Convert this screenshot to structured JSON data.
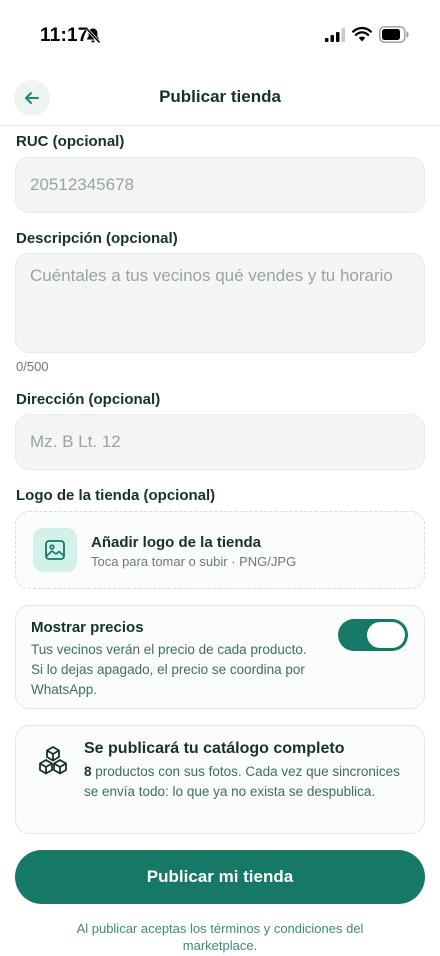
{
  "status_bar": {
    "time": "11:17"
  },
  "header": {
    "title": "Publicar tienda"
  },
  "form": {
    "ruc": {
      "label": "RUC (opcional)",
      "placeholder": "20512345678"
    },
    "descripcion": {
      "label": "Descripción (opcional)",
      "placeholder": "Cuéntales a tus vecinos qué vendes y tu horario",
      "counter": "0/500"
    },
    "direccion": {
      "label": "Dirección (opcional)",
      "placeholder": "Mz. B Lt. 12"
    },
    "logo": {
      "label": "Logo de la tienda (opcional)",
      "title": "Añadir logo de la tienda",
      "subtitle": "Toca para tomar o subir · PNG/JPG"
    }
  },
  "prices": {
    "title": "Mostrar precios",
    "description": "Tus vecinos verán el precio de cada producto. Si lo dejas apagado, el precio se coordina por WhatsApp.",
    "enabled": true
  },
  "catalog": {
    "title": "Se publicará tu catálogo completo",
    "count": "8",
    "description": " productos con sus fotos. Cada vez que sincronices se envía todo: lo que ya no exista se despublica."
  },
  "actions": {
    "publish_label": "Publicar mi tienda",
    "terms": "Al publicar aceptas los términos y condiciones del marketplace."
  },
  "colors": {
    "accent": "#167866",
    "icon_bg": "#d2f1e9",
    "text": "#15332b"
  },
  "icons": {
    "back": "arrow-left-icon",
    "logo": "image-icon",
    "catalog": "boxes-icon",
    "silent": "bell-slash-icon",
    "signal": "signal-icon",
    "wifi": "wifi-icon",
    "battery": "battery-icon"
  }
}
